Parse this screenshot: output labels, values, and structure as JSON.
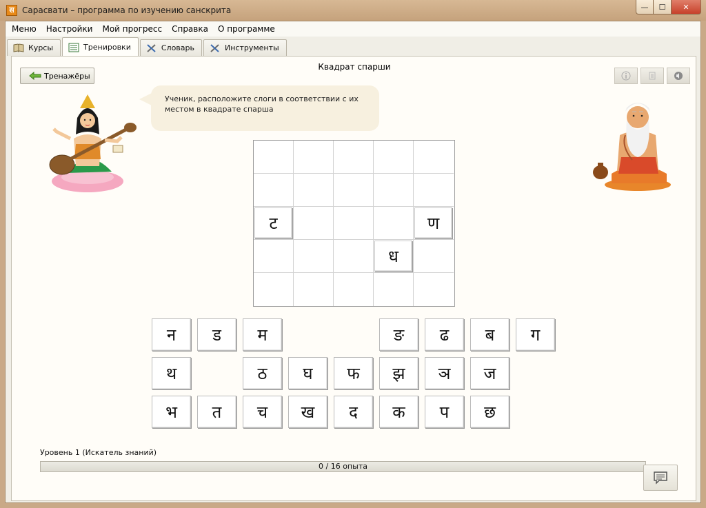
{
  "window": {
    "app_icon_glyph": "स",
    "title": "Сарасвати – программа по изучению санскрита",
    "controls": {
      "minimize": "—",
      "maximize": "☐",
      "close": "✕"
    }
  },
  "menu": [
    "Меню",
    "Настройки",
    "Мой прогресс",
    "Справка",
    "О программе"
  ],
  "tabs": [
    {
      "label": "Курсы",
      "icon": "book-icon",
      "active": false
    },
    {
      "label": "Тренировки",
      "icon": "list-icon",
      "active": true
    },
    {
      "label": "Словарь",
      "icon": "tools-icon",
      "active": false
    },
    {
      "label": "Инструменты",
      "icon": "tools-icon",
      "active": false
    }
  ],
  "screen": {
    "title": "Квадрат спарши",
    "back_button": "Тренажёры",
    "speech": "Ученик, расположите слоги в соответствии с их местом в квадрате спарша"
  },
  "grid": {
    "rows": 5,
    "cols": 5,
    "placed": [
      {
        "row": 2,
        "col": 0,
        "glyph": "ट"
      },
      {
        "row": 2,
        "col": 4,
        "glyph": "ण"
      },
      {
        "row": 3,
        "col": 3,
        "glyph": "ध"
      }
    ]
  },
  "tiles": [
    [
      "न",
      "ड",
      "म",
      "",
      "",
      "ङ",
      "ढ",
      "ब",
      "ग"
    ],
    [
      "थ",
      "",
      "ठ",
      "घ",
      "फ",
      "झ",
      "ञ",
      "ज",
      ""
    ],
    [
      "भ",
      "त",
      "च",
      "ख",
      "द",
      "क",
      "प",
      "छ",
      ""
    ]
  ],
  "progress": {
    "level_label": "Уровень 1 (Искатель знаний)",
    "text": "0 / 16 опыта",
    "current": 0,
    "max": 16
  },
  "colors": {
    "accent": "#c9a987",
    "bubble": "#f7f0df"
  }
}
